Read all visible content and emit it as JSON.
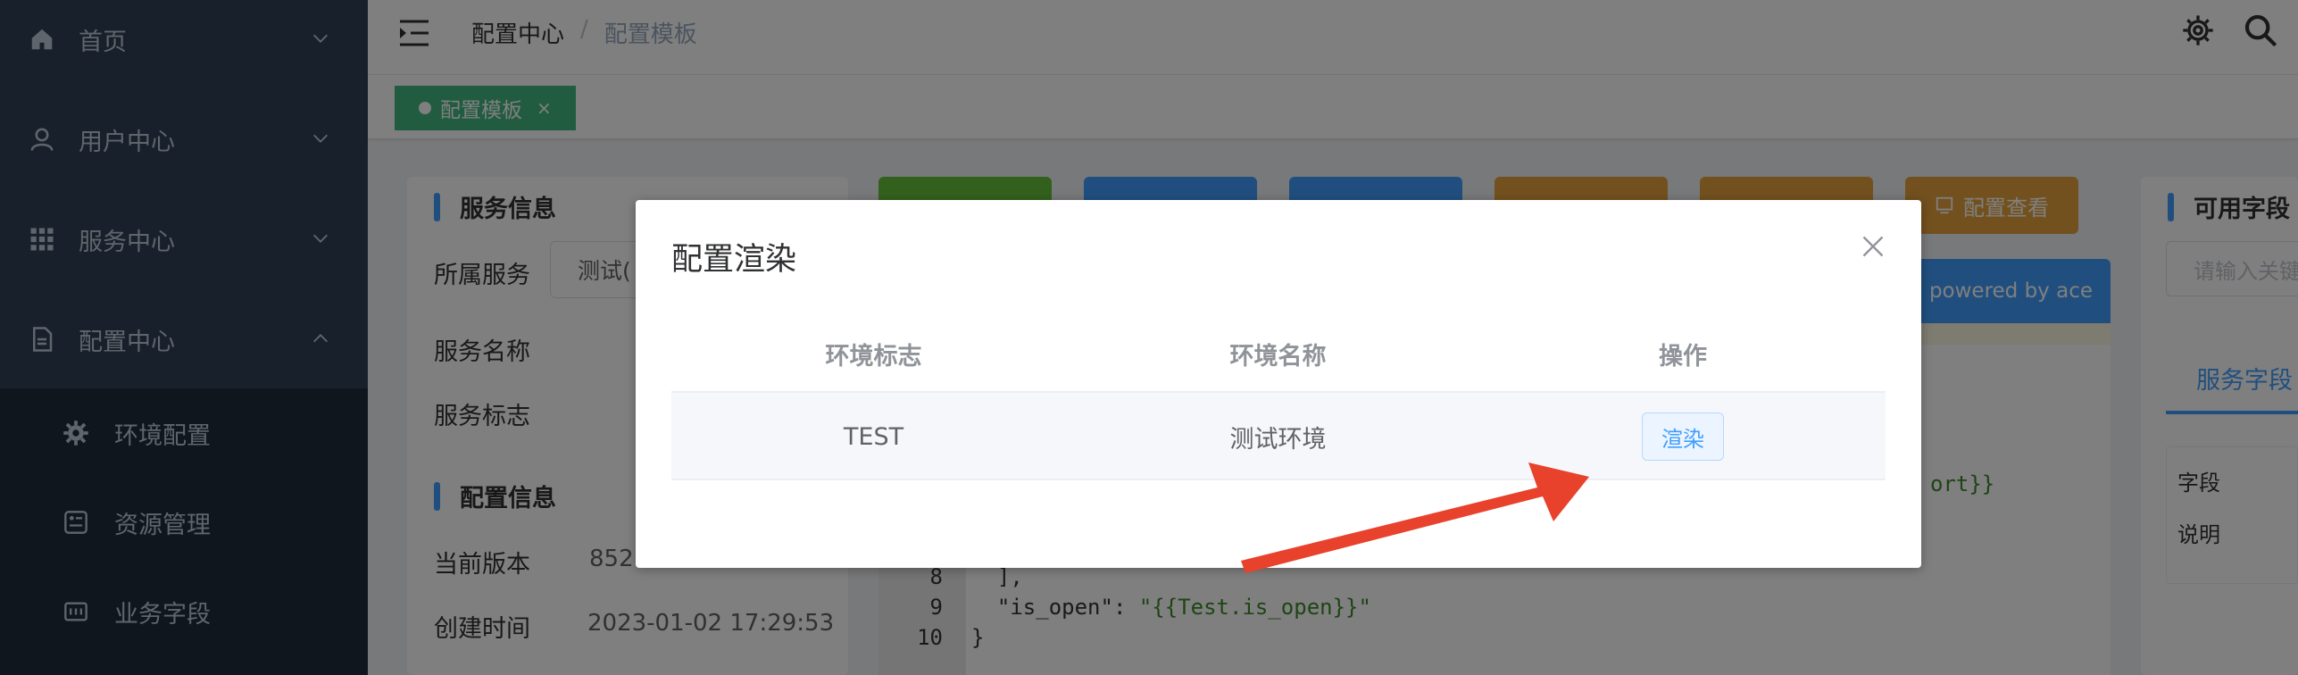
{
  "sidebar": {
    "items": [
      {
        "label": "首页",
        "icon": "home-icon"
      },
      {
        "label": "用户中心",
        "icon": "user-icon"
      },
      {
        "label": "服务中心",
        "icon": "grid-icon"
      },
      {
        "label": "配置中心",
        "icon": "document-icon"
      }
    ],
    "subitems": [
      {
        "label": "环境配置",
        "icon": "gear-icon"
      },
      {
        "label": "资源管理",
        "icon": "resource-icon"
      },
      {
        "label": "业务字段",
        "icon": "field-icon"
      }
    ]
  },
  "navbar": {
    "breadcrumb": [
      "配置中心",
      "/",
      "配置模板"
    ]
  },
  "tags": {
    "active": "配置模板",
    "close": "×",
    "color": "#42b983"
  },
  "left_panel": {
    "service_info_title": "服务信息",
    "service_label": "所属服务",
    "service_value": "测试(",
    "name_label": "服务名称",
    "key_label": "服务标志",
    "config_info_title": "配置信息",
    "version_label": "当前版本",
    "version_value": "852",
    "created_label": "创建时间",
    "created_value": "2023-01-02 17:29:53"
  },
  "toolbar": {
    "buttons": [
      {
        "label": "",
        "color": "#67c23a"
      },
      {
        "label": "",
        "color": "#409eff"
      },
      {
        "label": "",
        "color": "#409eff"
      },
      {
        "label": "",
        "color": "#e6a23c"
      },
      {
        "label": "",
        "color": "#e6a23c"
      },
      {
        "label": "配置查看",
        "color": "#e6a23c"
      }
    ]
  },
  "editor": {
    "powered": "powered by ace",
    "lines": [
      {
        "n": "8",
        "code": "  ],"
      },
      {
        "n": "9",
        "key": "  \"is_open\"",
        "colon": ": ",
        "val": "\"{{Test.is_open}}\""
      },
      {
        "n": "10",
        "code": "}"
      }
    ],
    "partial": "ort}}"
  },
  "right_panel": {
    "title": "可用字段",
    "search_placeholder": "请输入关键",
    "tab": "服务字段",
    "field_label": "字段",
    "desc_label": "说明"
  },
  "modal": {
    "title": "配置渲染",
    "columns": [
      "环境标志",
      "环境名称",
      "操作"
    ],
    "rows": [
      {
        "key": "TEST",
        "name": "测试环境",
        "action": "渲染"
      }
    ]
  },
  "colors": {
    "accent": "#409eff",
    "sidebar_bg": "#304156",
    "arrow": "#e8412c"
  }
}
